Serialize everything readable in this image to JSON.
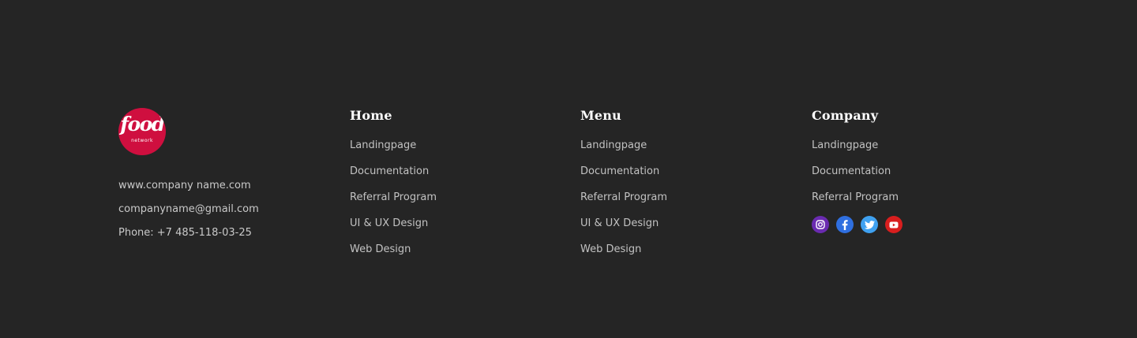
{
  "brand": {
    "logo_word": "food",
    "logo_sub": "network",
    "logo_color": "#cf0f3f",
    "website": "www.company name.com",
    "email": "companyname@gmail.com",
    "phone": "Phone: +7 485-118-03-25"
  },
  "columns": {
    "home": {
      "title": "Home",
      "links": [
        "Landingpage",
        "Documentation",
        "Referral Program",
        "UI & UX Design",
        "Web Design"
      ]
    },
    "menu": {
      "title": "Menu",
      "links": [
        "Landingpage",
        "Documentation",
        "Referral Program",
        "UI & UX Design",
        "Web Design"
      ]
    },
    "company": {
      "title": "Company",
      "links": [
        "Landingpage",
        "Documentation",
        "Referral Program"
      ]
    }
  },
  "social": [
    {
      "icon": "instagram-icon",
      "color": "#6a2bb0"
    },
    {
      "icon": "facebook-icon",
      "color": "#2f6fe0"
    },
    {
      "icon": "twitter-icon",
      "color": "#3fa1f0"
    },
    {
      "icon": "youtube-icon",
      "color": "#d81e1e"
    }
  ],
  "colors": {
    "background": "#252525",
    "heading": "#ffffff",
    "link": "#c2c2c2"
  }
}
